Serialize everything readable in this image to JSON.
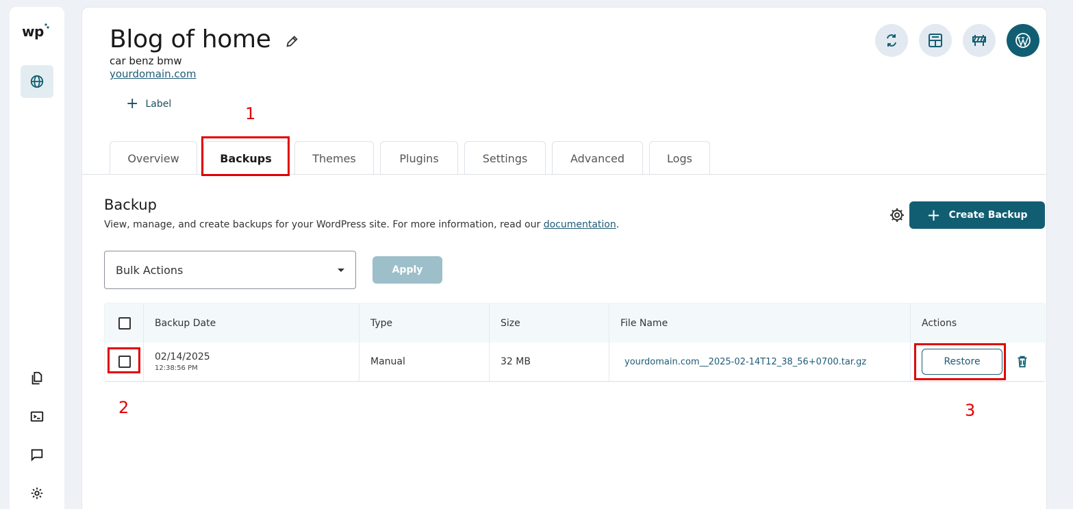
{
  "sidebar": {
    "logo": "wp",
    "icons": [
      "globe-icon",
      "copy-icon",
      "terminal-icon",
      "chat-icon",
      "gear-icon"
    ]
  },
  "site": {
    "title": "Blog of home",
    "subtitle": "car benz bmw",
    "url": "yourdomain.com",
    "label_button": "Label"
  },
  "top_icons": [
    "sync-icon",
    "layout-icon",
    "barrier-icon",
    "wordpress-icon"
  ],
  "tabs": [
    {
      "label": "Overview",
      "active": false
    },
    {
      "label": "Backups",
      "active": true
    },
    {
      "label": "Themes",
      "active": false
    },
    {
      "label": "Plugins",
      "active": false
    },
    {
      "label": "Settings",
      "active": false
    },
    {
      "label": "Advanced",
      "active": false
    },
    {
      "label": "Logs",
      "active": false
    }
  ],
  "backup": {
    "title": "Backup",
    "description": "View, manage, and create backups for your WordPress site. For more information, read our",
    "doc_link": "documentation",
    "desc_end": ".",
    "create_label": "Create Backup",
    "bulk_actions": "Bulk Actions",
    "apply_label": "Apply"
  },
  "table": {
    "headers": [
      "Backup Date",
      "Type",
      "Size",
      "File Name",
      "Actions"
    ],
    "rows": [
      {
        "date": "02/14/2025",
        "time": "12:38:56 PM",
        "type": "Manual",
        "size": "32 MB",
        "file": "yourdomain.com__2025-02-14T12_38_56+0700.tar.gz",
        "action": "Restore"
      }
    ]
  },
  "annotations": {
    "n1": "1",
    "n2": "2",
    "n3": "3",
    "color": "#e00000"
  },
  "colors": {
    "primary": "#115e73",
    "link": "#1d5b76",
    "apply_disabled": "#9dbfca"
  }
}
